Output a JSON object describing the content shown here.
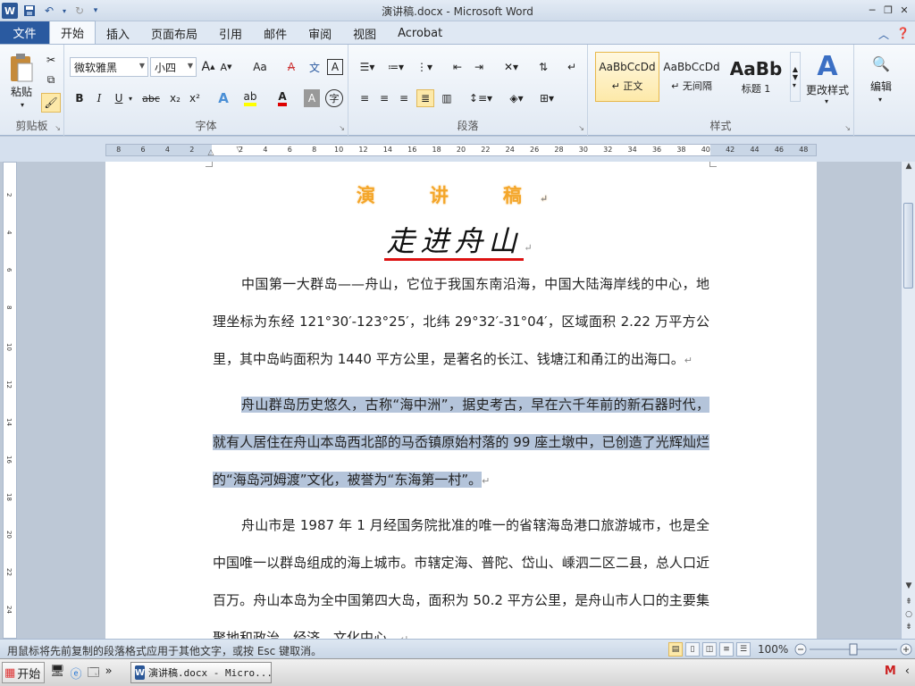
{
  "window": {
    "app_icon": "W",
    "title": "演讲稿.docx - Microsoft Word",
    "qat_icons": [
      "save-icon",
      "undo-icon",
      "redo-icon",
      "customize-icon"
    ],
    "win_buttons": [
      "─",
      "❐",
      "✕"
    ]
  },
  "tabs": {
    "file": "文件",
    "items": [
      "开始",
      "插入",
      "页面布局",
      "引用",
      "邮件",
      "审阅",
      "视图",
      "Acrobat"
    ],
    "active": "开始"
  },
  "ribbon": {
    "clipboard": {
      "paste": "粘贴",
      "group": "剪贴板"
    },
    "font": {
      "name": "微软雅黑",
      "size": "小四",
      "group": "字体",
      "bold": "B",
      "italic": "I",
      "underline": "U",
      "strike": "abc",
      "sub": "x₂",
      "sup": "x²",
      "grow": "A",
      "shrink": "A",
      "case": "Aa",
      "clear": "A",
      "phonetic": "文",
      "border": "A"
    },
    "paragraph": {
      "group": "段落"
    },
    "styles": {
      "group": "样式",
      "items": [
        {
          "sample": "AaBbCcDd",
          "name": "↵ 正文"
        },
        {
          "sample": "AaBbCcDd",
          "name": "↵ 无间隔"
        },
        {
          "sample": "AaBb",
          "name": "标题 1"
        }
      ],
      "change": "更改样式"
    },
    "editing": {
      "label": "编辑"
    }
  },
  "ruler": {
    "ticks": [
      "8",
      "6",
      "4",
      "2",
      "",
      "2",
      "4",
      "6",
      "8",
      "10",
      "12",
      "14",
      "16",
      "18",
      "20",
      "22",
      "24",
      "26",
      "28",
      "30",
      "32",
      "34",
      "36",
      "38",
      "40",
      "42",
      "44",
      "46",
      "48"
    ]
  },
  "vruler": {
    "ticks": [
      "2",
      "4",
      "6",
      "8",
      "10",
      "12",
      "14",
      "16",
      "18",
      "20",
      "22",
      "24"
    ]
  },
  "document": {
    "subtitle": "演　讲　稿",
    "title": "走进舟山",
    "paragraphs": [
      {
        "text": "中国第一大群岛——舟山，它位于我国东南沿海，中国大陆海岸线的中心，地理坐标为东经 121°30′-123°25′，北纬 29°32′-31°04′，区域面积 2.22 万平方公里，其中岛屿面积为 1440 平方公里，是著名的长江、钱塘江和甬江的出海口。",
        "selected": false
      },
      {
        "text": "舟山群岛历史悠久，古称“海中洲”，据史考古，早在六千年前的新石器时代，就有人居住在舟山本岛西北部的马岙镇原始村落的 99 座土墩中，已创造了光辉灿烂的“海岛河姆渡”文化，被誉为“东海第一村”。",
        "selected": true
      },
      {
        "text": "舟山市是 1987 年 1 月经国务院批准的唯一的省辖海岛港口旅游城市，也是全中国唯一以群岛组成的海上城市。市辖定海、普陀、岱山、嵊泗二区二县，总人口近百万。舟山本岛为全中国第四大岛，面积为 50.2 平方公里，是舟山市人口的主要集聚地和政治、经济、文化中心。",
        "selected": false
      }
    ],
    "para_mark": "↵"
  },
  "status": {
    "message": "用鼠标将先前复制的段落格式应用于其他文字，或按 Esc 键取消。",
    "zoom": "100%",
    "zoom_level": 0.5
  },
  "taskbar": {
    "start": "开始",
    "task_label": "演讲稿.docx - Micro...",
    "more": "»"
  },
  "colors": {
    "accent": "#2a5aa0",
    "selection": "#b4c4da",
    "subtitle": "#f4a62a",
    "underline": "#dd1111"
  }
}
